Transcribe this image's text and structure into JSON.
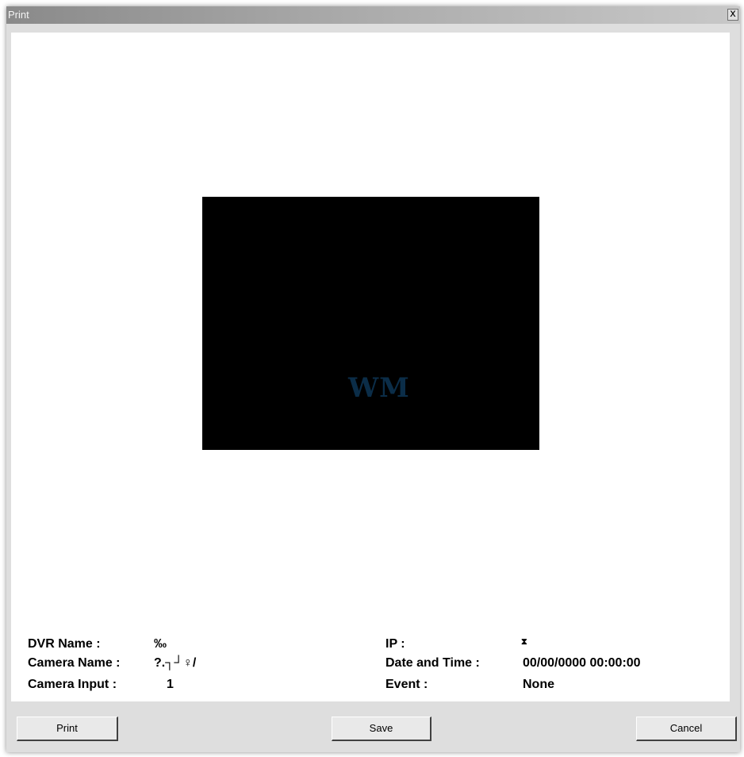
{
  "window": {
    "title": "Print",
    "close_label": "x"
  },
  "preview": {
    "watermark": "WM"
  },
  "info": {
    "dvr_name_label": "DVR Name :",
    "dvr_name_value": "‰",
    "camera_name_label": "Camera Name :",
    "camera_name_value": "?.┐┘♀/",
    "camera_input_label": "Camera Input :",
    "camera_input_value": "1",
    "ip_label": "IP :",
    "ip_value": "⧗",
    "datetime_label": "Date and Time :",
    "datetime_value": "00/00/0000 00:00:00",
    "event_label": "Event :",
    "event_value": "None"
  },
  "buttons": {
    "print": "Print",
    "save": "Save",
    "cancel": "Cancel"
  }
}
